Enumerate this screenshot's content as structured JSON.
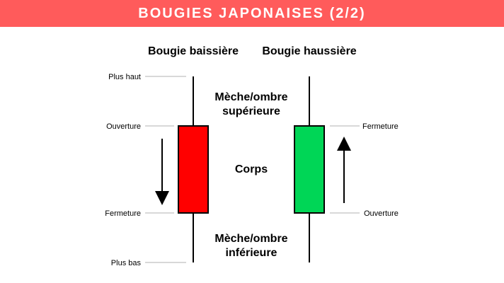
{
  "banner": {
    "title": "BOUGIES JAPONAISES (2/2)"
  },
  "headings": {
    "bearish": "Bougie baissière",
    "bullish": "Bougie haussière"
  },
  "left_labels": {
    "high": "Plus haut",
    "open": "Ouverture",
    "close": "Fermeture",
    "low": "Plus bas"
  },
  "right_labels": {
    "close": "Fermeture",
    "open": "Ouverture"
  },
  "center_labels": {
    "upper_wick_line1": "Mèche/ombre",
    "upper_wick_line2": "supérieure",
    "body": "Corps",
    "lower_wick_line1": "Mèche/ombre",
    "lower_wick_line2": "inférieure"
  },
  "colors": {
    "banner": "#ff5b5b",
    "bearish_body": "#ff0000",
    "bullish_body": "#00d656",
    "guide_line": "#b0b0b0"
  }
}
